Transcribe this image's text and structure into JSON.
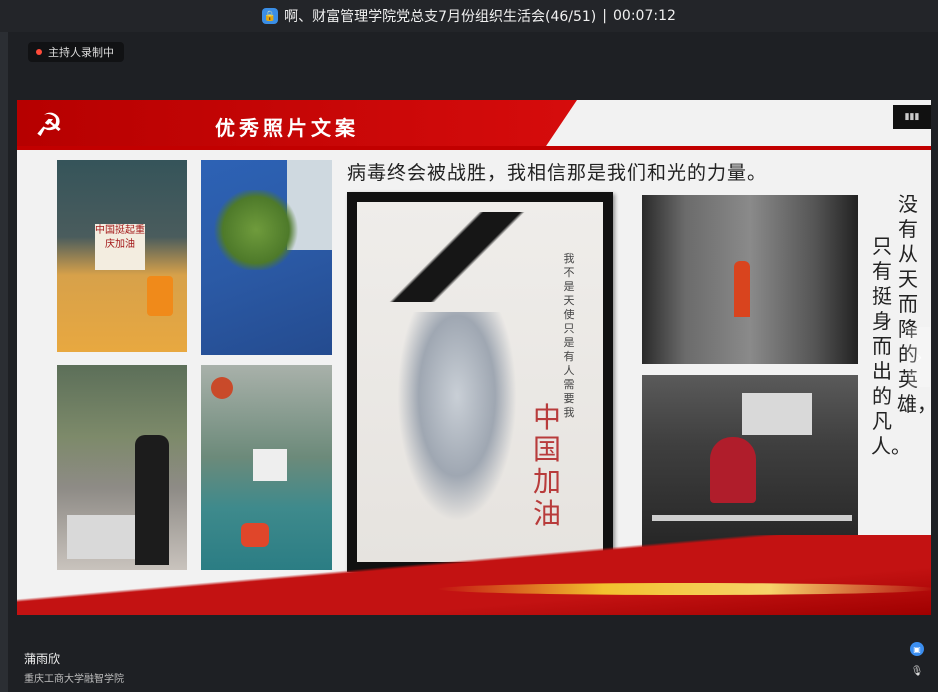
{
  "window": {
    "title": "啊、财富管理学院党总支7月份组织生活会(46/51)",
    "elapsed": "00:07:12",
    "separator": "|"
  },
  "recording_badge": {
    "label": "主持人录制中"
  },
  "slide": {
    "header_title": "优秀照片文案",
    "caption": "病毒终会被战胜，我相信那是我们和光的力量。",
    "vertical_text_right": "没有从天而降的英雄，",
    "vertical_text_left": "只有挺身而出的凡人。",
    "drawing_text_large": "中国加油",
    "drawing_text_small": "我不是天使只是有人需要我",
    "photo1_sign": "中国挺起重庆加油",
    "accent_red": "#c31212",
    "accent_gold": "#f2c12e"
  },
  "speaker": {
    "name": "蒲雨欣",
    "organization": "重庆工商大学融智学院"
  },
  "icons": {
    "lock": "lock-icon",
    "emblem": "party-emblem-icon",
    "next": "chevron-right-icon",
    "chat": "chat-icon",
    "mic": "mic-icon"
  }
}
